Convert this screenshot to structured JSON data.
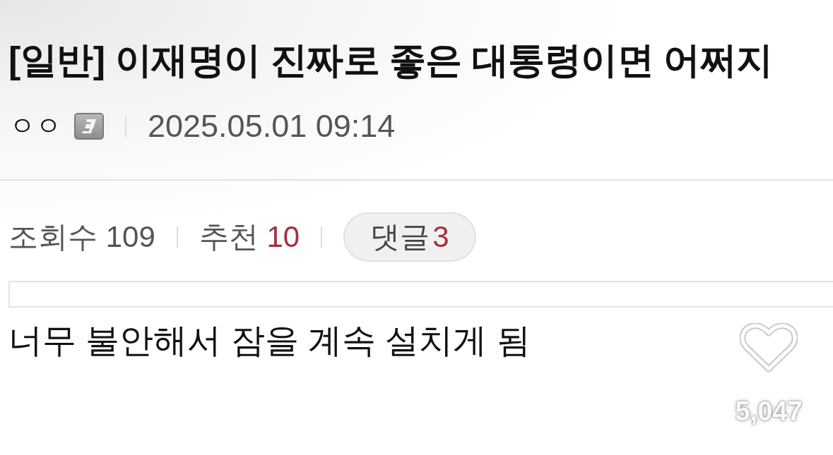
{
  "post": {
    "title": "[일반] 이재명이 진짜로 좋은 대통령이면 어쩌지",
    "author": "ㅇㅇ",
    "date": "2025.05.01 09:14"
  },
  "stats": [
    {
      "label": "조회수",
      "value": "109",
      "highlight": false
    },
    {
      "label": "추천",
      "value": "10",
      "highlight": true
    }
  ],
  "comments": {
    "label": "댓글",
    "value": "3"
  },
  "body": "너무 불안해서 잠을 계속 설치게 됨",
  "overlay": {
    "likes": "5,047"
  }
}
